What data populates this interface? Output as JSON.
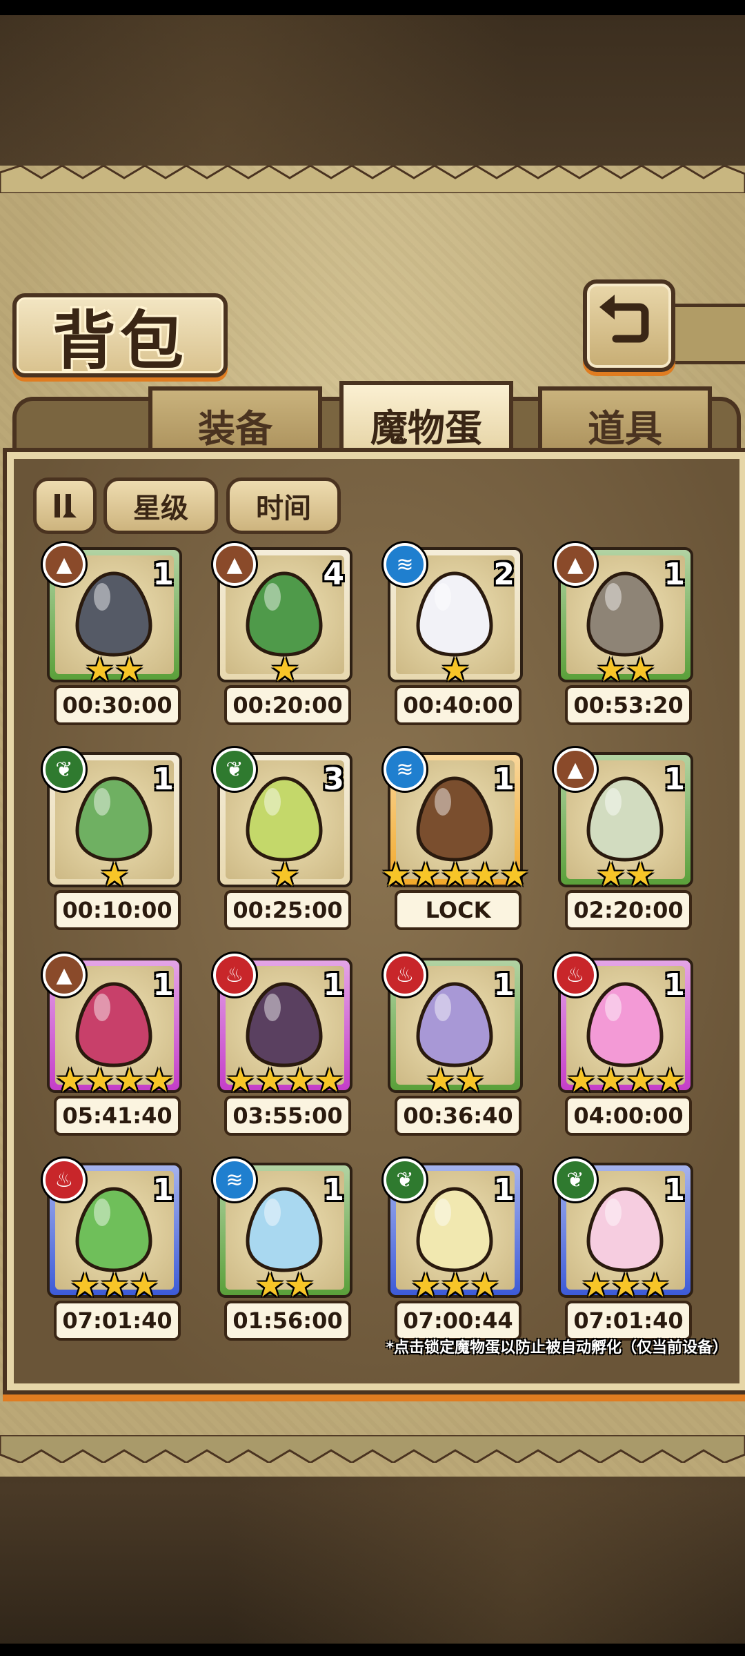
{
  "title": "背包",
  "tabs": [
    "装备",
    "魔物蛋",
    "道具"
  ],
  "active_tab": "魔物蛋",
  "sort": {
    "toggle_icon": "sort-toggle-icon",
    "star_label": "星级",
    "time_label": "时间"
  },
  "element_colors": {
    "earth": "#8a4a2a",
    "water": "#1f7fcf",
    "grass": "#2f7a2f",
    "fire": "#c8262a"
  },
  "rarity_colors": {
    "green": "#5aa03a",
    "cream": "#e8d9b0",
    "gold": "#f2a92a",
    "purple": "#c43ec9",
    "blue": "#3d5bd8"
  },
  "eggs": [
    {
      "element": "earth",
      "count": "1",
      "stars": 2,
      "timer": "00:30:00",
      "frame": "green",
      "color": "#555a66"
    },
    {
      "element": "earth",
      "count": "4",
      "stars": 1,
      "timer": "00:20:00",
      "frame": "cream",
      "color": "#4f9a4a"
    },
    {
      "element": "water",
      "count": "2",
      "stars": 1,
      "timer": "00:40:00",
      "frame": "cream",
      "color": "#f2f2f7"
    },
    {
      "element": "earth",
      "count": "1",
      "stars": 2,
      "timer": "00:53:20",
      "frame": "green",
      "color": "#8e8476"
    },
    {
      "element": "grass",
      "count": "1",
      "stars": 1,
      "timer": "00:10:00",
      "frame": "cream",
      "color": "#6fb062"
    },
    {
      "element": "grass",
      "count": "3",
      "stars": 1,
      "timer": "00:25:00",
      "frame": "cream",
      "color": "#c4d86a"
    },
    {
      "element": "water",
      "count": "1",
      "stars": 5,
      "timer": "LOCK",
      "frame": "gold",
      "color": "#7a4e2e"
    },
    {
      "element": "earth",
      "count": "1",
      "stars": 2,
      "timer": "02:20:00",
      "frame": "green",
      "color": "#d2dcc0"
    },
    {
      "element": "earth",
      "count": "1",
      "stars": 4,
      "timer": "05:41:40",
      "frame": "purple",
      "color": "#c8406a"
    },
    {
      "element": "fire",
      "count": "1",
      "stars": 4,
      "timer": "03:55:00",
      "frame": "purple",
      "color": "#5a4060"
    },
    {
      "element": "fire",
      "count": "1",
      "stars": 2,
      "timer": "00:36:40",
      "frame": "green",
      "color": "#a898d6"
    },
    {
      "element": "fire",
      "count": "1",
      "stars": 4,
      "timer": "04:00:00",
      "frame": "purple",
      "color": "#f39ad6"
    },
    {
      "element": "fire",
      "count": "1",
      "stars": 3,
      "timer": "07:01:40",
      "frame": "blue",
      "color": "#6fbf5a"
    },
    {
      "element": "water",
      "count": "1",
      "stars": 2,
      "timer": "01:56:00",
      "frame": "green",
      "color": "#a9d8f0"
    },
    {
      "element": "grass",
      "count": "1",
      "stars": 3,
      "timer": "07:00:44",
      "frame": "blue",
      "color": "#f1e8b0"
    },
    {
      "element": "grass",
      "count": "1",
      "stars": 3,
      "timer": "07:01:40",
      "frame": "blue",
      "color": "#f6cde0"
    }
  ],
  "footnote": "*点击锁定魔物蛋以防止被自动孵化（仅当前设备）"
}
